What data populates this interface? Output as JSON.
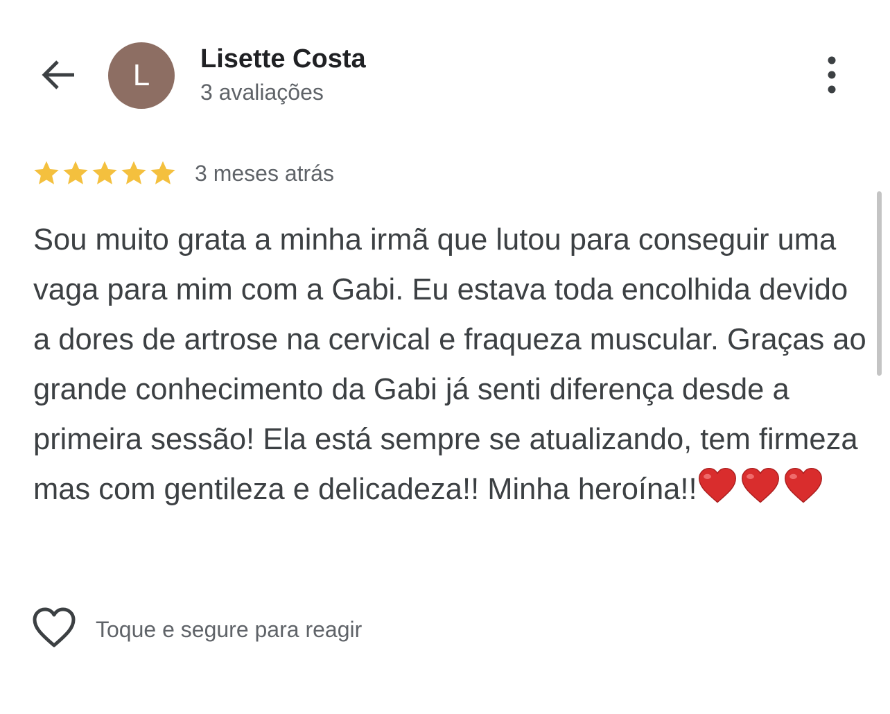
{
  "header": {
    "back_icon": "arrow-back-icon",
    "avatar_letter": "L",
    "avatar_color": "#8d6e63",
    "reviewer_name": "Lisette Costa",
    "review_count": "3 avaliações",
    "more_icon": "more-vertical-icon"
  },
  "review": {
    "rating": 5,
    "max_rating": 5,
    "star_color": "#f4c03e",
    "star_icon": "star-icon",
    "date": "3 meses atrás",
    "text": "Sou muito grata a minha irmã que lutou para conseguir uma vaga para mim com a Gabi. Eu estava toda encolhida devido a dores de artrose na cervical e fraqueza muscular. Graças ao grande conhecimento da Gabi já senti diferença desde a primeira sessão! Ela está sempre se atualizando, tem firmeza mas com gentileza e delicadeza!! Minha heroína!!",
    "trailing_emoji": [
      "red-heart-emoji",
      "red-heart-emoji",
      "red-heart-emoji"
    ]
  },
  "reaction": {
    "icon": "heart-outline-icon",
    "label": "Toque e segure para reagir"
  }
}
